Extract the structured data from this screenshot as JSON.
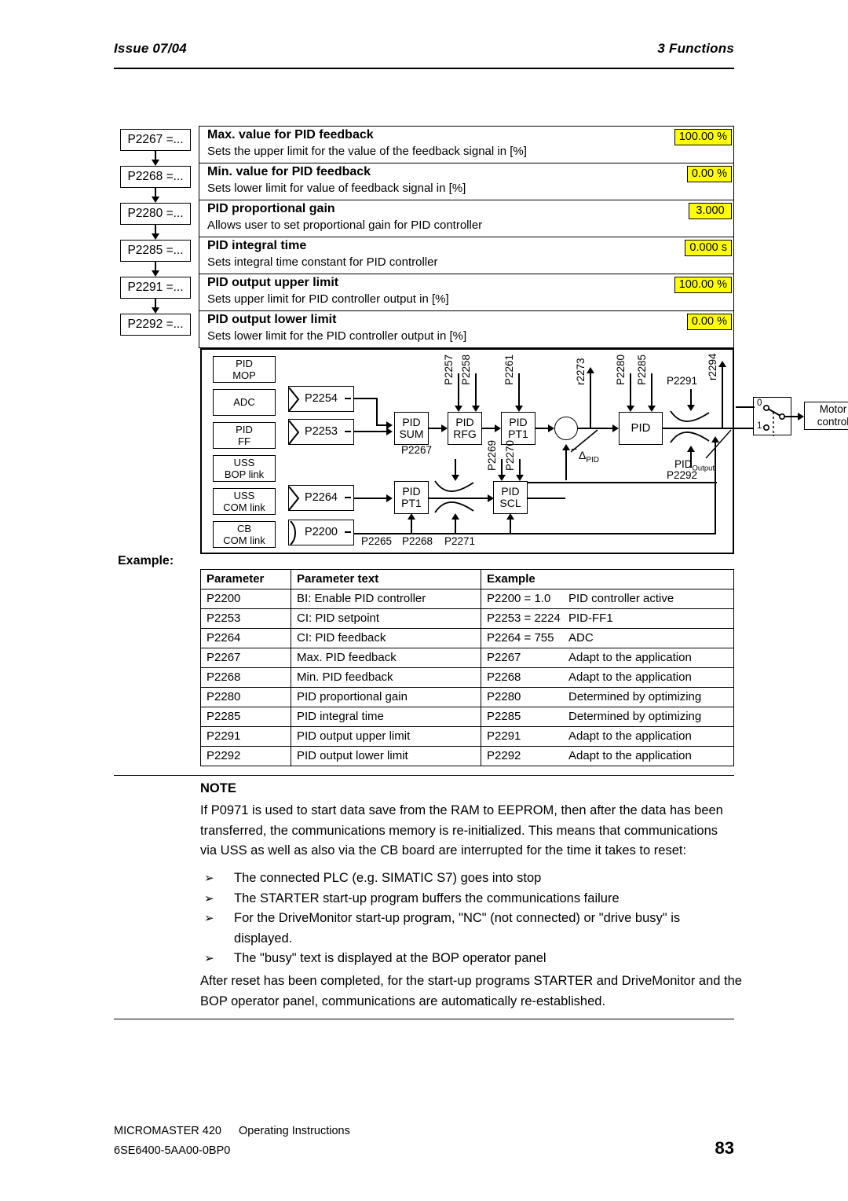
{
  "header": {
    "left": "Issue 07/04",
    "right": "3  Functions"
  },
  "param_list": [
    {
      "key": "P2267 =...",
      "title": "Max. value for PID feedback",
      "desc": "Sets the upper limit for the value of the feedback signal in [%]",
      "value": "100.00 %"
    },
    {
      "key": "P2268 =...",
      "title": "Min. value for PID feedback",
      "desc": "Sets lower limit for value of feedback signal in [%]",
      "value": "0.00 %"
    },
    {
      "key": "P2280 =...",
      "title": "PID proportional gain",
      "desc": "Allows user to set proportional gain for PID controller",
      "value": "3.000"
    },
    {
      "key": "P2285 =...",
      "title": "PID integral time",
      "desc": "Sets integral time constant for PID controller",
      "value": "0.000 s"
    },
    {
      "key": "P2291 =...",
      "title": "PID output upper limit",
      "desc": "Sets upper limit for PID controller output in [%]",
      "value": "100.00 %"
    },
    {
      "key": "P2292 =...",
      "title": "PID output lower limit",
      "desc": "Sets lower limit for the PID controller output in [%]",
      "value": "0.00 %"
    }
  ],
  "diagram": {
    "sources": [
      {
        "line1": "PID",
        "line2": "MOP"
      },
      {
        "line1": "ADC",
        "line2": ""
      },
      {
        "line1": "PID",
        "line2": "FF"
      },
      {
        "line1": "USS",
        "line2": "BOP link"
      },
      {
        "line1": "USS",
        "line2": "COM link"
      },
      {
        "line1": "CB",
        "line2": "COM link"
      }
    ],
    "selectors": [
      {
        "label": "P2254"
      },
      {
        "label": "P2253"
      },
      {
        "label": "P2264"
      },
      {
        "label": "P2200"
      }
    ],
    "blocks": [
      {
        "line1": "PID",
        "line2": "SUM"
      },
      {
        "line1": "PID",
        "line2": "RFG"
      },
      {
        "line1": "PID",
        "line2": "PT1"
      },
      {
        "line1": "PID",
        "line2": ""
      },
      {
        "line1": "PID",
        "line2": "PT1"
      },
      {
        "line1": "PID",
        "line2": "SCL"
      }
    ],
    "motor_control": {
      "line1": "Motor",
      "line2": "control"
    },
    "labels": {
      "p2257": "P2257",
      "p2258": "P2258",
      "p2261": "P2261",
      "r2273": "r2273",
      "p2280": "P2280",
      "p2285": "P2285",
      "r2294": "r2294",
      "p2291": "P2291",
      "p2292": "P2292",
      "p2269": "P2269",
      "p2270": "P2270",
      "p2267": "P2267",
      "p2265": "P2265",
      "p2268": "P2268",
      "p2271": "P2271",
      "delta_pid": "Δ",
      "delta_pid_sub": "PID",
      "minus_sign": "−",
      "pid_output": "PID",
      "pid_output_sub": "Output",
      "switch_0": "0",
      "switch_1": "1"
    }
  },
  "example": {
    "label": "Example:",
    "columns": [
      "Parameter",
      "Parameter text",
      "Example"
    ],
    "rows": [
      {
        "parameter": "P2200",
        "text": "BI: Enable PID controller",
        "ex_value": "P2200 = 1.0",
        "ex_note": "PID controller active"
      },
      {
        "parameter": "P2253",
        "text": "CI: PID setpoint",
        "ex_value": "P2253 = 2224",
        "ex_note": "PID-FF1"
      },
      {
        "parameter": "P2264",
        "text": "CI: PID feedback",
        "ex_value": "P2264 = 755",
        "ex_note": "ADC"
      },
      {
        "parameter": "P2267",
        "text": "Max. PID feedback",
        "ex_value": "P2267",
        "ex_note": "Adapt to the application"
      },
      {
        "parameter": "P2268",
        "text": "Min. PID feedback",
        "ex_value": "P2268",
        "ex_note": "Adapt to the application"
      },
      {
        "parameter": "P2280",
        "text": "PID proportional gain",
        "ex_value": "P2280",
        "ex_note": "Determined by optimizing"
      },
      {
        "parameter": "P2285",
        "text": "PID integral time",
        "ex_value": "P2285",
        "ex_note": "Determined by optimizing"
      },
      {
        "parameter": "P2291",
        "text": "PID output upper limit",
        "ex_value": "P2291",
        "ex_note": "Adapt to the application"
      },
      {
        "parameter": "P2292",
        "text": "PID output lower limit",
        "ex_value": "P2292",
        "ex_note": "Adapt to the application"
      }
    ]
  },
  "note": {
    "title": "NOTE",
    "body": "If P0971 is used to start data save from the RAM to EEPROM, then after the data has been transferred, the communications memory is re-initialized. This means that communications via USS as well as also via the CB board are interrupted for the time it takes to reset:",
    "bullet_glyph": "➢",
    "bullets": [
      "The connected PLC (e.g. SIMATIC S7) goes into stop",
      "The STARTER start-up program buffers the communications failure",
      "For the DriveMonitor start-up program, \"NC\" (not connected) or \"drive busy\" is displayed.",
      "The \"busy\" text is displayed at the BOP operator panel"
    ],
    "closing": "After reset has been completed, for the start-up programs STARTER and DriveMonitor and the BOP operator panel, communications are automatically re-established."
  },
  "footer": {
    "product": "MICROMASTER 420",
    "doc_type": "Operating Instructions",
    "order_number": "6SE6400-5AA00-0BP0",
    "page_number": "83"
  }
}
